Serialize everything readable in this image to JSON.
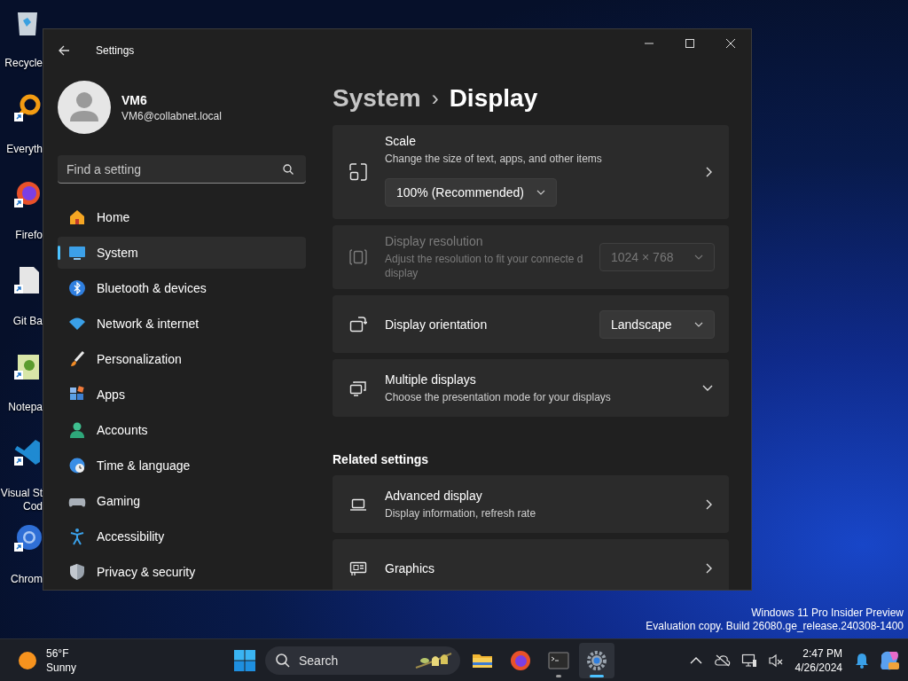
{
  "desktop_icons": [
    {
      "label": "Recycle"
    },
    {
      "label": "Everyth"
    },
    {
      "label": "Firefo"
    },
    {
      "label": "Git Ba"
    },
    {
      "label": "Notepa"
    },
    {
      "label": "Visual St\nCod"
    },
    {
      "label": "Chrom"
    }
  ],
  "window": {
    "title": "Settings",
    "profile": {
      "name": "VM6",
      "email": "VM6@collabnet.local"
    },
    "search": {
      "placeholder": "Find a setting"
    },
    "nav": [
      {
        "label": "Home",
        "selected": false
      },
      {
        "label": "System",
        "selected": true
      },
      {
        "label": "Bluetooth & devices",
        "selected": false
      },
      {
        "label": "Network & internet",
        "selected": false
      },
      {
        "label": "Personalization",
        "selected": false
      },
      {
        "label": "Apps",
        "selected": false
      },
      {
        "label": "Accounts",
        "selected": false
      },
      {
        "label": "Time & language",
        "selected": false
      },
      {
        "label": "Gaming",
        "selected": false
      },
      {
        "label": "Accessibility",
        "selected": false
      },
      {
        "label": "Privacy & security",
        "selected": false
      }
    ],
    "breadcrumb": {
      "parent": "System",
      "separator": "›",
      "current": "Display"
    },
    "cards": [
      {
        "kind": "scale",
        "title": "Scale",
        "subtitle": "Change the size of text, apps, and other items",
        "value": "100% (Recommended)",
        "disabled": false
      },
      {
        "kind": "select",
        "title": "Display resolution",
        "subtitle": "Adjust the resolution to fit your connecte d display",
        "value": "1024 × 768",
        "disabled": true
      },
      {
        "kind": "select",
        "title": "Display orientation",
        "value": "Landscape",
        "disabled": false
      },
      {
        "kind": "expander",
        "title": "Multiple displays",
        "subtitle": "Choose the presentation mode for your displays",
        "expanded": false,
        "disabled": false
      }
    ],
    "related": {
      "heading": "Related settings",
      "cards": [
        {
          "kind": "link",
          "title": "Advanced display",
          "subtitle": "Display information, refresh rate"
        },
        {
          "kind": "link",
          "title": "Graphics"
        }
      ]
    }
  },
  "watermark": [
    "Windows 11 Pro Insider Preview",
    "Evaluation copy. Build 26080.ge_release.240308-1400"
  ],
  "taskbar": {
    "weather": {
      "temperature": "56°F",
      "condition": "Sunny"
    },
    "search": {
      "placeholder": "Search"
    },
    "apps": [
      {
        "running": false,
        "selected": false
      },
      {
        "running": false,
        "selected": false
      },
      {
        "running": true,
        "selected": false
      },
      {
        "running": true,
        "selected": true
      }
    ],
    "clock": {
      "time": "2:47 PM",
      "date": "4/26/2024"
    }
  }
}
